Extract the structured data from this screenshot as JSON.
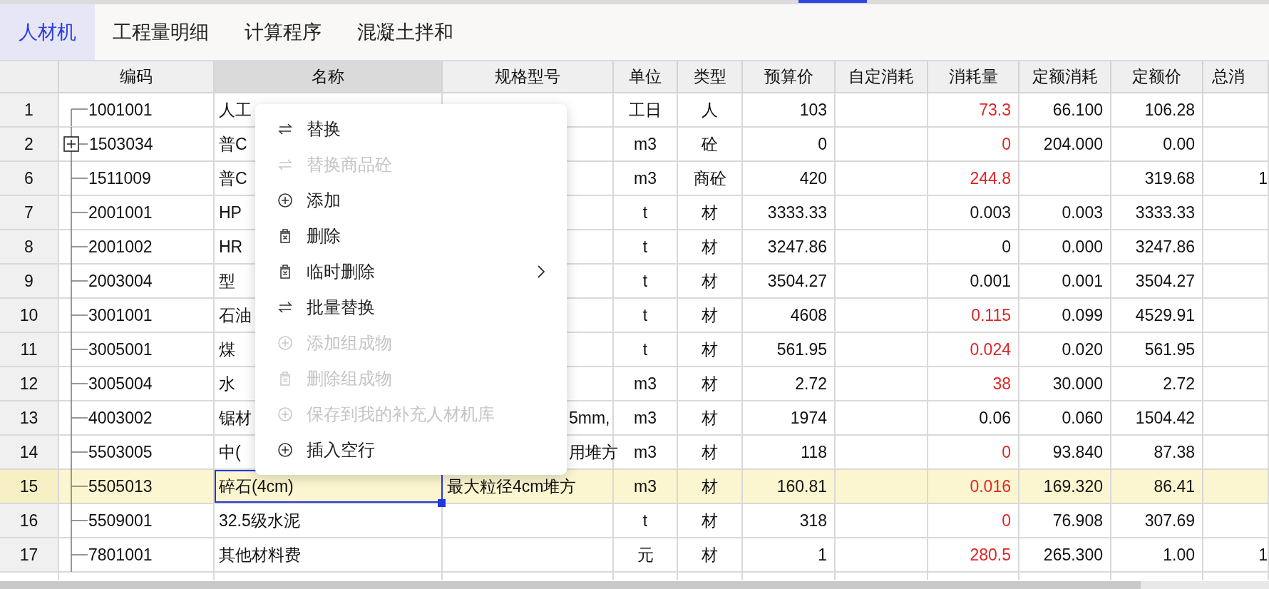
{
  "tabs": [
    {
      "label": "人材机",
      "selected": true
    },
    {
      "label": "工程量明细",
      "selected": false
    },
    {
      "label": "计算程序",
      "selected": false
    },
    {
      "label": "混凝土拌和",
      "selected": false
    }
  ],
  "table": {
    "columns": [
      "",
      "编码",
      "名称",
      "规格型号",
      "单位",
      "类型",
      "预算价",
      "自定消耗",
      "消耗量",
      "定额消耗",
      "定额价",
      "总消"
    ],
    "rows": [
      {
        "no": "1",
        "code": "1001001",
        "expandable": false,
        "name": "人工",
        "spec": "",
        "unit": "工日",
        "type": "人",
        "budget": "103",
        "custom": "",
        "consumption": "73.3",
        "over": true,
        "quota_consumption": "66.100",
        "quota_price": "106.28",
        "total": "",
        "selected": false
      },
      {
        "no": "2",
        "code": "1503034",
        "expandable": true,
        "name": "普C",
        "spec": "",
        "unit": "m3",
        "type": "砼",
        "budget": "0",
        "custom": "",
        "consumption": "0",
        "over": true,
        "quota_consumption": "204.000",
        "quota_price": "0.00",
        "total": "",
        "selected": false
      },
      {
        "no": "6",
        "code": "1511009",
        "expandable": false,
        "name": "普C",
        "spec": "",
        "unit": "m3",
        "type": "商砼",
        "budget": "420",
        "custom": "",
        "consumption": "244.8",
        "over": true,
        "quota_consumption": "",
        "quota_price": "319.68",
        "total": "1",
        "selected": false
      },
      {
        "no": "7",
        "code": "2001001",
        "expandable": false,
        "name": "HP",
        "spec": "",
        "unit": "t",
        "type": "材",
        "budget": "3333.33",
        "custom": "",
        "consumption": "0.003",
        "over": false,
        "quota_consumption": "0.003",
        "quota_price": "3333.33",
        "total": "",
        "selected": false
      },
      {
        "no": "8",
        "code": "2001002",
        "expandable": false,
        "name": "HR",
        "spec": "",
        "unit": "t",
        "type": "材",
        "budget": "3247.86",
        "custom": "",
        "consumption": "0",
        "over": false,
        "quota_consumption": "0.000",
        "quota_price": "3247.86",
        "total": "",
        "selected": false
      },
      {
        "no": "9",
        "code": "2003004",
        "expandable": false,
        "name": "型",
        "spec": "",
        "unit": "t",
        "type": "材",
        "budget": "3504.27",
        "custom": "",
        "consumption": "0.001",
        "over": false,
        "quota_consumption": "0.001",
        "quota_price": "3504.27",
        "total": "",
        "selected": false
      },
      {
        "no": "10",
        "code": "3001001",
        "expandable": false,
        "name": "石油",
        "spec": "",
        "unit": "t",
        "type": "材",
        "budget": "4608",
        "custom": "",
        "consumption": "0.115",
        "over": true,
        "quota_consumption": "0.099",
        "quota_price": "4529.91",
        "total": "",
        "selected": false
      },
      {
        "no": "11",
        "code": "3005001",
        "expandable": false,
        "name": "煤",
        "spec": "",
        "unit": "t",
        "type": "材",
        "budget": "561.95",
        "custom": "",
        "consumption": "0.024",
        "over": true,
        "quota_consumption": "0.020",
        "quota_price": "561.95",
        "total": "",
        "selected": false
      },
      {
        "no": "12",
        "code": "3005004",
        "expandable": false,
        "name": "水",
        "spec": "",
        "unit": "m3",
        "type": "材",
        "budget": "2.72",
        "custom": "",
        "consumption": "38",
        "over": true,
        "quota_consumption": "30.000",
        "quota_price": "2.72",
        "total": "",
        "selected": false
      },
      {
        "no": "13",
        "code": "4003002",
        "expandable": false,
        "name": "锯材",
        "spec": "5mm,",
        "spec_partial": true,
        "unit": "m3",
        "type": "材",
        "budget": "1974",
        "custom": "",
        "consumption": "0.06",
        "over": false,
        "quota_consumption": "0.060",
        "quota_price": "1504.42",
        "total": "",
        "selected": false
      },
      {
        "no": "14",
        "code": "5503005",
        "expandable": false,
        "name": "中(",
        "spec": "用堆方",
        "spec_partial": true,
        "unit": "m3",
        "type": "材",
        "budget": "118",
        "custom": "",
        "consumption": "0",
        "over": true,
        "quota_consumption": "93.840",
        "quota_price": "87.38",
        "total": "",
        "selected": false
      },
      {
        "no": "15",
        "code": "5505013",
        "expandable": false,
        "name": "碎石(4cm)",
        "spec": "最大粒径4cm堆方",
        "spec_partial": false,
        "unit": "m3",
        "type": "材",
        "budget": "160.81",
        "custom": "",
        "consumption": "0.016",
        "over": true,
        "quota_consumption": "169.320",
        "quota_price": "86.41",
        "total": "",
        "selected": true
      },
      {
        "no": "16",
        "code": "5509001",
        "expandable": false,
        "name": "32.5级水泥",
        "spec": "",
        "unit": "t",
        "type": "材",
        "budget": "318",
        "custom": "",
        "consumption": "0",
        "over": true,
        "quota_consumption": "76.908",
        "quota_price": "307.69",
        "total": "",
        "selected": false
      },
      {
        "no": "17",
        "code": "7801001",
        "expandable": false,
        "name": "其他材料费",
        "spec": "",
        "unit": "元",
        "type": "材",
        "budget": "1",
        "custom": "",
        "consumption": "280.5",
        "over": true,
        "quota_consumption": "265.300",
        "quota_price": "1.00",
        "total": "1",
        "selected": false
      }
    ]
  },
  "context_menu": {
    "items": [
      {
        "label": "替换",
        "kind": "swap",
        "disabled": false,
        "submenu": false
      },
      {
        "label": "替换商品砼",
        "kind": "swap",
        "disabled": true,
        "submenu": false
      },
      {
        "label": "添加",
        "kind": "add",
        "disabled": false,
        "submenu": false
      },
      {
        "label": "删除",
        "kind": "delete",
        "disabled": false,
        "submenu": false
      },
      {
        "label": "临时删除",
        "kind": "delete",
        "disabled": false,
        "submenu": true
      },
      {
        "label": "批量替换",
        "kind": "swap",
        "disabled": false,
        "submenu": false
      },
      {
        "label": "添加组成物",
        "kind": "add",
        "disabled": true,
        "submenu": false
      },
      {
        "label": "删除组成物",
        "kind": "delete",
        "disabled": true,
        "submenu": false
      },
      {
        "label": "保存到我的补充人材机库",
        "kind": "add",
        "disabled": true,
        "submenu": false
      },
      {
        "label": "插入空行",
        "kind": "add",
        "disabled": false,
        "submenu": false
      }
    ]
  }
}
